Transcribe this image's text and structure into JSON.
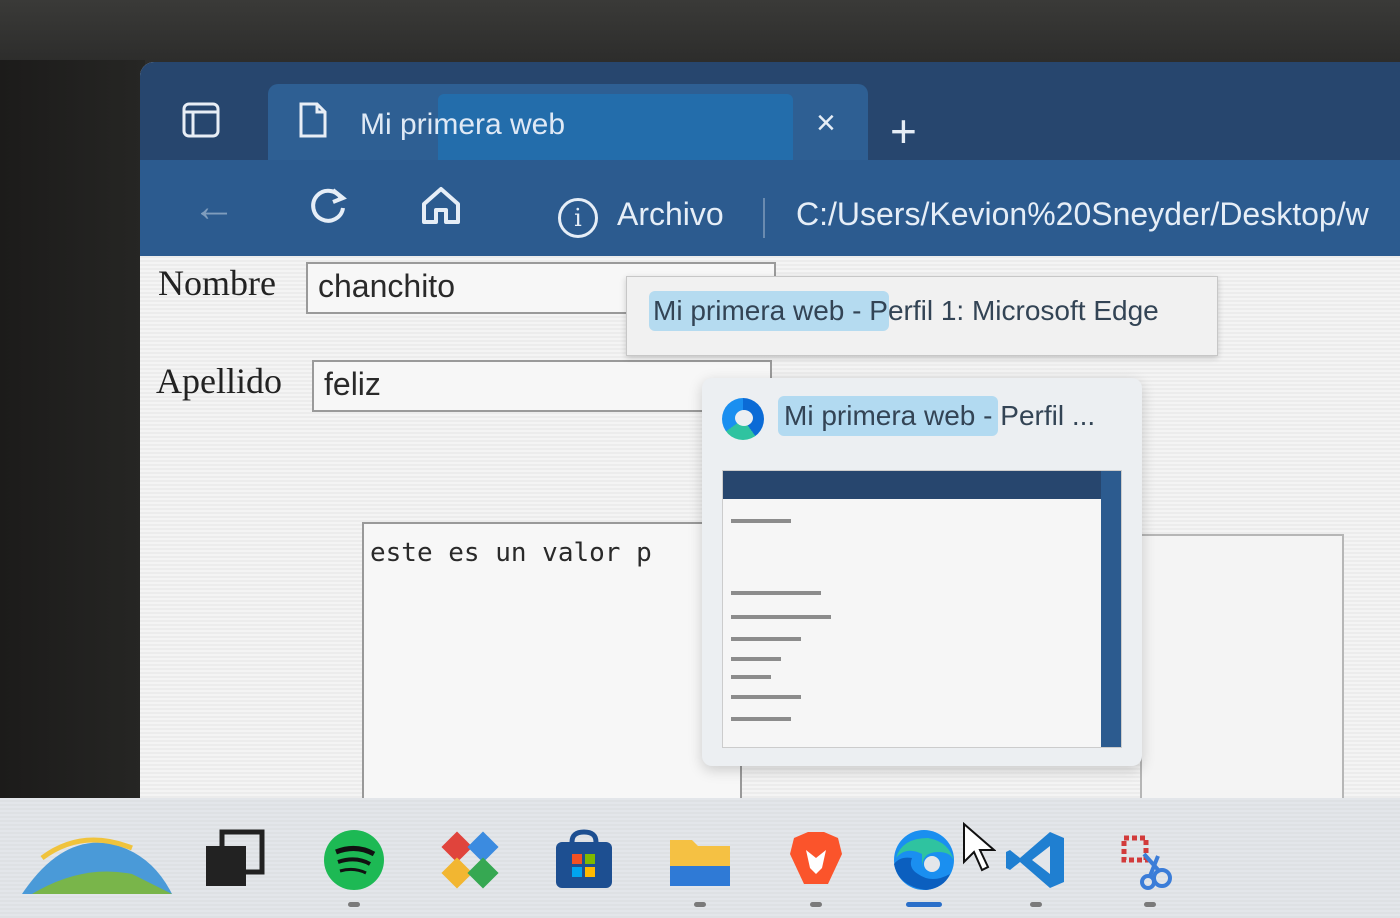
{
  "browser": {
    "tab": {
      "title": "Mi primera web",
      "close_glyph": "×"
    },
    "new_tab_glyph": "+",
    "toolbar": {
      "back_glyph": "←",
      "info_glyph": "i",
      "address_label": "Archivo",
      "address_url": "C:/Users/Kevion%20Sneyder/Desktop/w"
    }
  },
  "form": {
    "nombre_label": "Nombre",
    "nombre_value": "chanchito",
    "apellido_label": "Apellido",
    "apellido_value": "feliz",
    "textarea_value": "este es un valor p"
  },
  "tooltip": {
    "text": "Mi primera web - Perfil 1: Microsoft Edge"
  },
  "taskbar_preview": {
    "title": "Mi primera web - Perfil ..."
  },
  "taskbar": {
    "apps": [
      "weather-widget-icon",
      "task-view-icon",
      "spotify-icon",
      "app-icon",
      "microsoft-store-icon",
      "file-explorer-icon",
      "brave-icon",
      "edge-icon",
      "vscode-icon",
      "snipping-tool-icon"
    ],
    "active_app": "edge-icon"
  },
  "colors": {
    "tab_strip": "#27466e",
    "toolbar": "#2c5b8f",
    "accent": "#2a6fc9"
  }
}
